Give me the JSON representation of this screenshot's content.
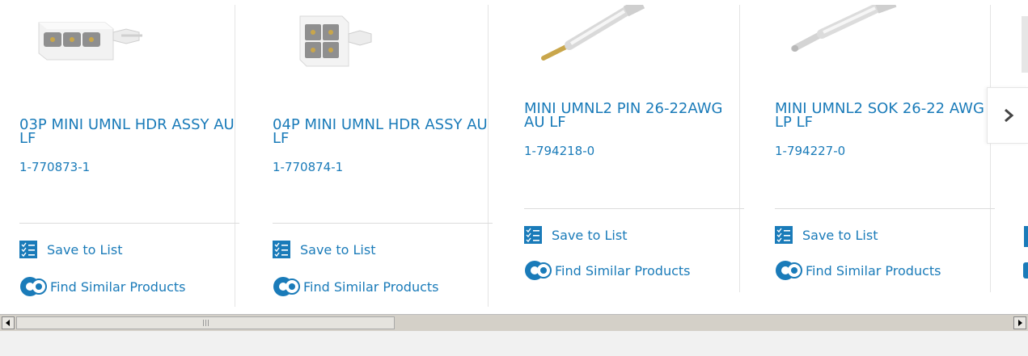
{
  "products": [
    {
      "title": "03P MINI UMNL HDR ASSY AU LF",
      "part_number": "1-770873-1",
      "image": "connector-3pos-icon"
    },
    {
      "title": "04P MINI UMNL HDR ASSY AU LF",
      "part_number": "1-770874-1",
      "image": "connector-4pos-icon"
    },
    {
      "title": "MINI UMNL2 PIN 26-22AWG AU LF",
      "part_number": "1-794218-0",
      "image": "pin-contact-icon"
    },
    {
      "title": "MINI UMNL2 SOK 26-22 AWG LP LF",
      "part_number": "1-794227-0",
      "image": "socket-contact-icon"
    }
  ],
  "actions": {
    "save_to_list": "Save to List",
    "find_similar": "Find Similar Products"
  },
  "carousel": {
    "next_icon": "chevron-right-icon"
  },
  "scrollbar": {
    "thumb_fraction": 0.38
  },
  "colors": {
    "link": "#1a7bb9",
    "icon_bg": "#1a7bb9"
  }
}
